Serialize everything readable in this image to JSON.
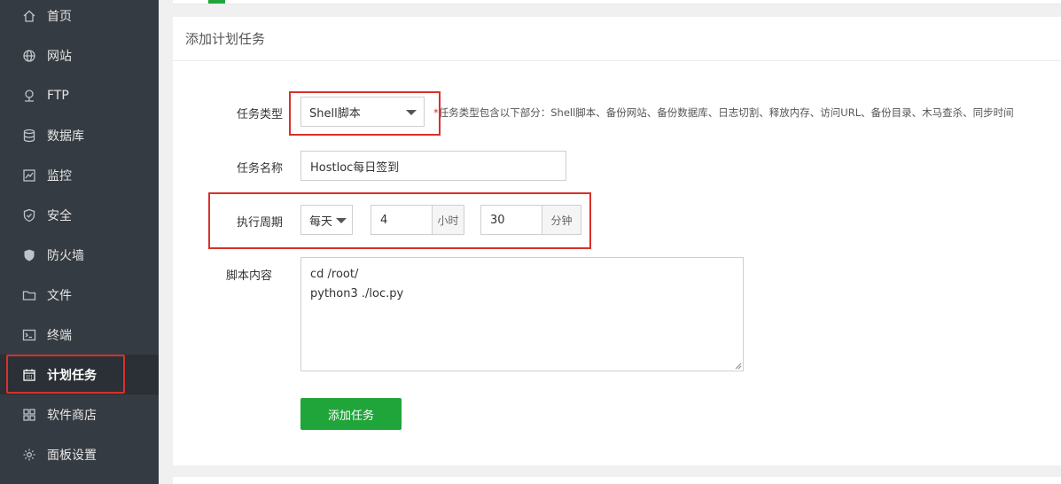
{
  "sidebar": {
    "items": [
      {
        "label": "首页",
        "icon": "home-icon"
      },
      {
        "label": "网站",
        "icon": "globe-icon"
      },
      {
        "label": "FTP",
        "icon": "ftp-icon"
      },
      {
        "label": "数据库",
        "icon": "database-icon"
      },
      {
        "label": "监控",
        "icon": "monitor-icon"
      },
      {
        "label": "安全",
        "icon": "shield-check-icon"
      },
      {
        "label": "防火墙",
        "icon": "shield-icon"
      },
      {
        "label": "文件",
        "icon": "folder-icon"
      },
      {
        "label": "终端",
        "icon": "terminal-icon"
      },
      {
        "label": "计划任务",
        "icon": "calendar-icon",
        "active": true
      },
      {
        "label": "软件商店",
        "icon": "grid-icon"
      },
      {
        "label": "面板设置",
        "icon": "gear-icon"
      }
    ]
  },
  "panel": {
    "title": "添加计划任务",
    "task_type": {
      "label": "任务类型",
      "value": "Shell脚本",
      "hint_star": "*",
      "hint": "任务类型包含以下部分：Shell脚本、备份网站、备份数据库、日志切割、释放内存、访问URL、备份目录、木马查杀、同步时间"
    },
    "task_name": {
      "label": "任务名称",
      "value": "Hostloc每日签到"
    },
    "period": {
      "label": "执行周期",
      "cycle": "每天",
      "hour": "4",
      "hour_unit": "小时",
      "minute": "30",
      "minute_unit": "分钟"
    },
    "script": {
      "label": "脚本内容",
      "content": "cd /root/\npython3 ./loc.py"
    },
    "submit_label": "添加任务"
  },
  "colors": {
    "sidebar_bg": "#353b42",
    "accent_green": "#20a53a",
    "highlight_red": "#d9302a"
  }
}
